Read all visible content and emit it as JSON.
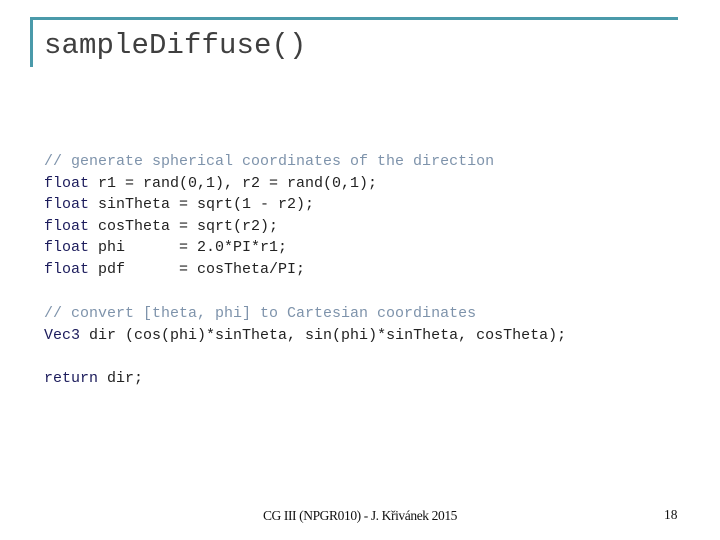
{
  "slide": {
    "title": "sampleDiffuse()",
    "accent_color": "#4a9aaa",
    "code_blocks": [
      {
        "lines": [
          [
            {
              "type": "comment",
              "text": "// generate spherical coordinates of the direction"
            }
          ],
          [
            {
              "type": "keyword",
              "text": "float"
            },
            {
              "type": "plain",
              "text": " r1 = rand(0,1), r2 = rand(0,1);"
            }
          ],
          [
            {
              "type": "keyword",
              "text": "float"
            },
            {
              "type": "plain",
              "text": " sinTheta = sqrt(1 - r2);"
            }
          ],
          [
            {
              "type": "keyword",
              "text": "float"
            },
            {
              "type": "plain",
              "text": " cosTheta = sqrt(r2);"
            }
          ],
          [
            {
              "type": "keyword",
              "text": "float"
            },
            {
              "type": "plain",
              "text": " phi      = 2.0*PI*r1;"
            }
          ],
          [
            {
              "type": "keyword",
              "text": "float"
            },
            {
              "type": "plain",
              "text": " pdf      = cosTheta/PI;"
            }
          ]
        ]
      },
      {
        "lines": [
          [
            {
              "type": "comment",
              "text": "// convert [theta, phi] to Cartesian coordinates"
            }
          ],
          [
            {
              "type": "keyword",
              "text": "Vec3"
            },
            {
              "type": "plain",
              "text": " dir (cos(phi)*sinTheta, sin(phi)*sinTheta, cosTheta);"
            }
          ]
        ]
      },
      {
        "lines": [
          [
            {
              "type": "keyword",
              "text": "return"
            },
            {
              "type": "plain",
              "text": " dir;"
            }
          ]
        ]
      }
    ],
    "footer": "CG III (NPGR010) - J. Křivánek 2015",
    "page_number": "18"
  }
}
